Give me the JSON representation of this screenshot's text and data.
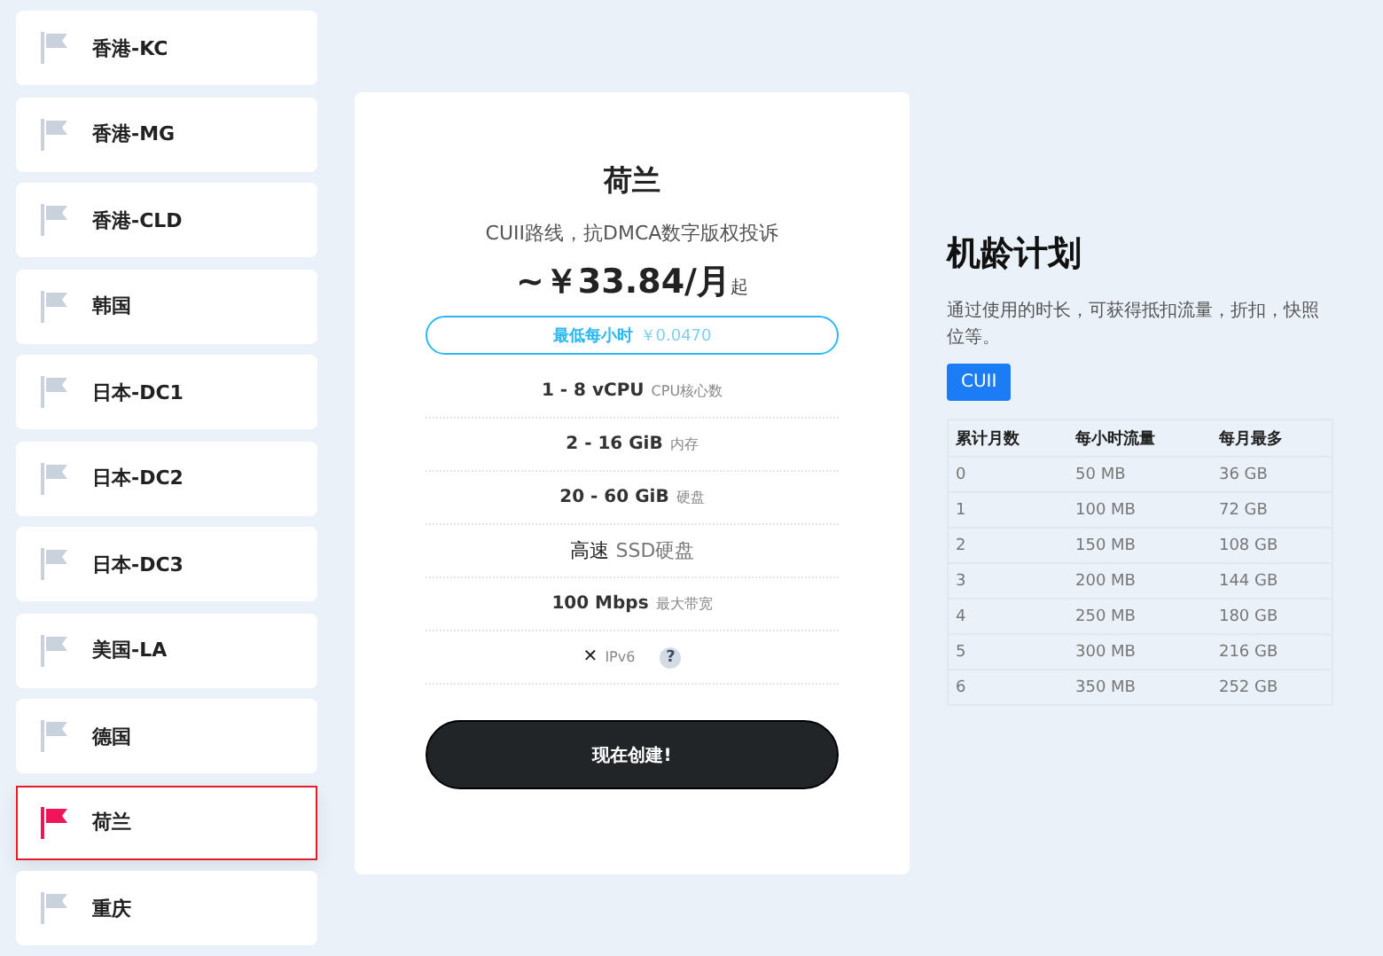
{
  "regions": [
    {
      "label": "香港-KC",
      "selected": false
    },
    {
      "label": "香港-MG",
      "selected": false
    },
    {
      "label": "香港-CLD",
      "selected": false
    },
    {
      "label": "韩国",
      "selected": false
    },
    {
      "label": "日本-DC1",
      "selected": false
    },
    {
      "label": "日本-DC2",
      "selected": false
    },
    {
      "label": "日本-DC3",
      "selected": false
    },
    {
      "label": "美国-LA",
      "selected": false
    },
    {
      "label": "德国",
      "selected": false
    },
    {
      "label": "荷兰",
      "selected": true
    },
    {
      "label": "重庆",
      "selected": false
    }
  ],
  "plan": {
    "title": "荷兰",
    "subtitle": "CUII路线，抗DMCA数字版权投诉",
    "price": "~￥33.84/月",
    "price_suffix": "起",
    "hourly_label": "最低每小时",
    "hourly_price": "￥0.0470",
    "specs": [
      {
        "kind": "text",
        "main": "1 - 8 vCPU",
        "sub": "CPU核心数"
      },
      {
        "kind": "text",
        "main": "2 - 16 GiB",
        "sub": "内存"
      },
      {
        "kind": "text",
        "main": "20 - 60 GiB",
        "sub": "硬盘"
      },
      {
        "kind": "large",
        "main": "高速",
        "sub": "SSD硬盘"
      },
      {
        "kind": "text",
        "main": "100 Mbps",
        "sub": "最大带宽"
      },
      {
        "kind": "unsupported",
        "main": "✕",
        "sub": "IPv6",
        "help": "?"
      }
    ],
    "button": "现在创建!"
  },
  "loyalty": {
    "title": "机龄计划",
    "description": "通过使用的时长，可获得抵扣流量，折扣，快照位等。",
    "tag": "CUII",
    "table": {
      "columns": [
        "累计月数",
        "每小时流量",
        "每月最多"
      ],
      "rows": [
        [
          "0",
          "50 MB",
          "36 GB"
        ],
        [
          "1",
          "100 MB",
          "72 GB"
        ],
        [
          "2",
          "150 MB",
          "108 GB"
        ],
        [
          "3",
          "200 MB",
          "144 GB"
        ],
        [
          "4",
          "250 MB",
          "180 GB"
        ],
        [
          "5",
          "300 MB",
          "216 GB"
        ],
        [
          "6",
          "350 MB",
          "252 GB"
        ]
      ]
    }
  }
}
